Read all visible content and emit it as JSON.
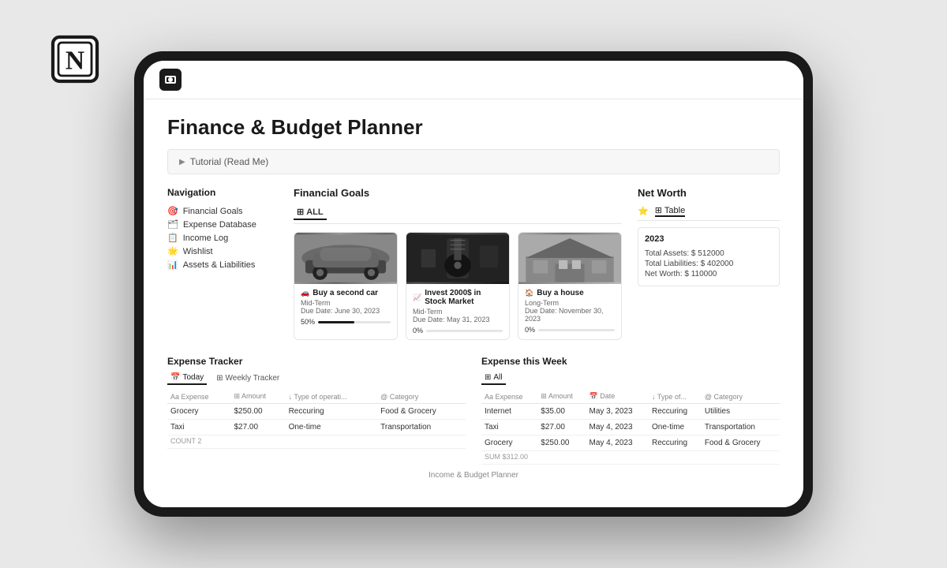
{
  "logo": {
    "alt": "Notion Logo"
  },
  "page": {
    "title": "Finance & Budget Planner",
    "icon_label": "budget-icon"
  },
  "tutorial": {
    "label": "Tutorial (Read Me)"
  },
  "navigation": {
    "heading": "Navigation",
    "items": [
      {
        "icon": "🎯",
        "label": "Financial Goals"
      },
      {
        "icon": "🗂",
        "label": "Expense Database"
      },
      {
        "icon": "📋",
        "label": "Income Log"
      },
      {
        "icon": "🌟",
        "label": "Wishlist"
      },
      {
        "icon": "📊",
        "label": "Assets & Liabilities"
      }
    ]
  },
  "financial_goals": {
    "heading": "Financial Goals",
    "filter": "ALL",
    "cards": [
      {
        "icon": "🚗",
        "title": "Buy a second car",
        "term": "Mid-Term",
        "due": "Due Date: June 30, 2023",
        "progress": 50,
        "img_type": "car"
      },
      {
        "icon": "📈",
        "title": "Invest 2000$ in Stock Market",
        "term": "Mid-Term",
        "due": "Due Date: May 31, 2023",
        "progress": 0,
        "img_type": "guitar"
      },
      {
        "icon": "🏠",
        "title": "Buy a house",
        "term": "Long-Term",
        "due": "Due Date: November 30, 2023",
        "progress": 0,
        "img_type": "house"
      }
    ]
  },
  "net_worth": {
    "heading": "Net Worth",
    "tabs": [
      "⭐",
      "Table"
    ],
    "active_tab": "Table",
    "year": "2023",
    "rows": [
      {
        "label": "Total Assets: $ 512000"
      },
      {
        "label": "Total Liabilities: $ 402000"
      },
      {
        "label": "Net Worth: $ 110000"
      }
    ]
  },
  "expense_tracker": {
    "heading": "Expense Tracker",
    "tabs": [
      "Today",
      "Weekly Tracker"
    ],
    "active_tab": "Today",
    "columns": [
      "Aa Expense",
      "⊞ Amount",
      "↓ Type of operati...",
      "@ Category"
    ],
    "rows": [
      {
        "expense": "Grocery",
        "amount": "$250.00",
        "type": "Reccuring",
        "category": "Food & Grocery"
      },
      {
        "expense": "Taxi",
        "amount": "$27.00",
        "type": "One-time",
        "category": "Transportation"
      }
    ],
    "count_label": "COUNT 2"
  },
  "expense_this_week": {
    "heading": "Expense this Week",
    "filter": "All",
    "columns": [
      "Aa Expense",
      "⊞ Amount",
      "📅 Date",
      "↓ Type of...",
      "@ Category"
    ],
    "rows": [
      {
        "expense": "Internet",
        "amount": "$35.00",
        "date": "May 3, 2023",
        "type": "Reccuring",
        "category": "Utilities"
      },
      {
        "expense": "Taxi",
        "amount": "$27.00",
        "date": "May 4, 2023",
        "type": "One-time",
        "category": "Transportation"
      },
      {
        "expense": "Grocery",
        "amount": "$250.00",
        "date": "May 4, 2023",
        "type": "Reccuring",
        "category": "Food & Grocery"
      }
    ],
    "sum_label": "SUM $312.00"
  },
  "bottom_label": "Income & Budget Planner"
}
